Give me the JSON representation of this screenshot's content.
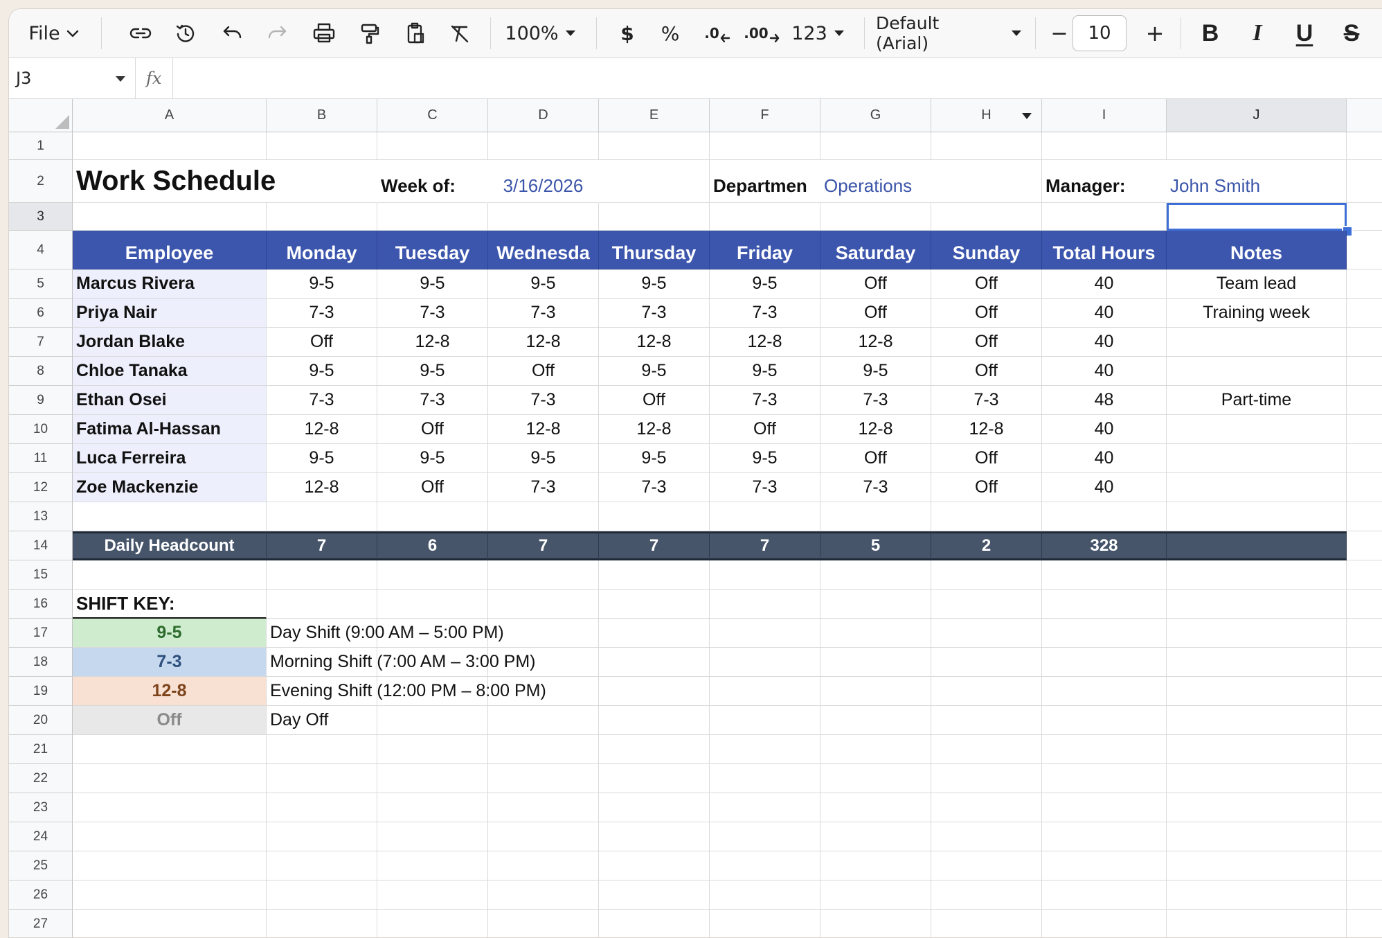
{
  "toolbar": {
    "file_label": "File",
    "zoom": "100%",
    "currency": "$",
    "percent": "%",
    "decimal_decrease": ".0",
    "decimal_increase": ".00",
    "number_format": "123",
    "font": "Default (Arial)",
    "minus": "−",
    "font_size": "10",
    "plus": "+",
    "bold": "B",
    "italic": "I",
    "underline": "U",
    "strikethrough": "S"
  },
  "formula_bar": {
    "cell_ref": "J3",
    "fx": "fx",
    "content": ""
  },
  "columns": [
    "A",
    "B",
    "C",
    "D",
    "E",
    "F",
    "G",
    "H",
    "I",
    "J"
  ],
  "rows": [
    "1",
    "2",
    "3",
    "4",
    "5",
    "6",
    "7",
    "8",
    "9",
    "10",
    "11",
    "12",
    "13",
    "14",
    "15",
    "16",
    "17",
    "18",
    "19",
    "20",
    "21",
    "22",
    "23",
    "24",
    "25",
    "26",
    "27"
  ],
  "sheet": {
    "title": "Work Schedule",
    "week_label": "Week of:",
    "week_value": "3/16/2026",
    "dept_label": "Departmen",
    "dept_value": "Operations",
    "manager_label": "Manager:",
    "manager_value": "John Smith",
    "headers": [
      "Employee",
      "Monday",
      "Tuesday",
      "Wednesda",
      "Thursday",
      "Friday",
      "Saturday",
      "Sunday",
      "Total Hours",
      "Notes"
    ],
    "employees": [
      [
        "Marcus Rivera",
        "9-5",
        "9-5",
        "9-5",
        "9-5",
        "9-5",
        "Off",
        "Off",
        "40",
        "Team lead"
      ],
      [
        "Priya Nair",
        "7-3",
        "7-3",
        "7-3",
        "7-3",
        "7-3",
        "Off",
        "Off",
        "40",
        "Training week"
      ],
      [
        "Jordan Blake",
        "Off",
        "12-8",
        "12-8",
        "12-8",
        "12-8",
        "12-8",
        "Off",
        "40",
        ""
      ],
      [
        "Chloe Tanaka",
        "9-5",
        "9-5",
        "Off",
        "9-5",
        "9-5",
        "9-5",
        "Off",
        "40",
        ""
      ],
      [
        "Ethan Osei",
        "7-3",
        "7-3",
        "7-3",
        "Off",
        "7-3",
        "7-3",
        "7-3",
        "48",
        "Part-time"
      ],
      [
        "Fatima Al-Hassan",
        "12-8",
        "Off",
        "12-8",
        "12-8",
        "Off",
        "12-8",
        "12-8",
        "40",
        ""
      ],
      [
        "Luca Ferreira",
        "9-5",
        "9-5",
        "9-5",
        "9-5",
        "9-5",
        "Off",
        "Off",
        "40",
        ""
      ],
      [
        "Zoe Mackenzie",
        "12-8",
        "Off",
        "7-3",
        "7-3",
        "7-3",
        "7-3",
        "Off",
        "40",
        ""
      ]
    ],
    "headcount": [
      "Daily Headcount",
      "7",
      "6",
      "7",
      "7",
      "7",
      "5",
      "2",
      "328",
      ""
    ],
    "shift_key_label": "SHIFT KEY:",
    "shift_key": [
      {
        "code": "9-5",
        "desc": "Day Shift (9:00 AM – 5:00 PM)",
        "bg": "#cfeccf",
        "fg": "#2e6b2e"
      },
      {
        "code": "7-3",
        "desc": "Morning Shift (7:00 AM – 3:00 PM)",
        "bg": "#c6d8ee",
        "fg": "#2d4f7c"
      },
      {
        "code": "12-8",
        "desc": "Evening Shift (12:00 PM – 8:00 PM)",
        "bg": "#f8e1d3",
        "fg": "#7d431b"
      },
      {
        "code": "Off",
        "desc": "Day Off",
        "bg": "#e8e8e8",
        "fg": "#8a8a8a"
      }
    ]
  },
  "colors": {
    "header_blue": "#3c56ad",
    "headcount_dark": "#46556a",
    "employee_bg": "#edf0fc",
    "accent_text": "#3b55a9"
  }
}
